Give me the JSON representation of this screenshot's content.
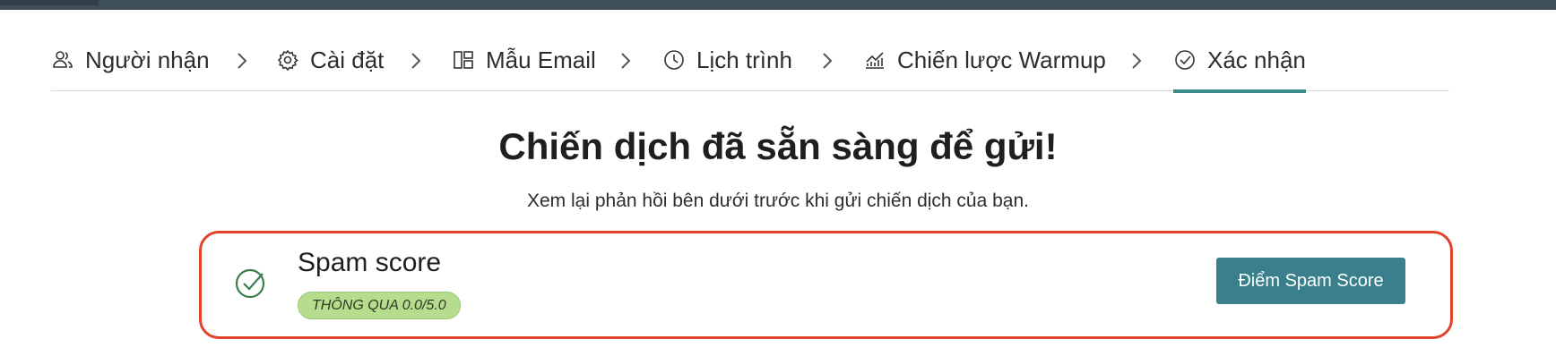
{
  "stepper": {
    "steps": [
      {
        "label": "Người nhận",
        "icon": "users-icon"
      },
      {
        "label": "Cài đặt",
        "icon": "gear-icon"
      },
      {
        "label": "Mẫu Email",
        "icon": "layout-icon"
      },
      {
        "label": "Lịch trình",
        "icon": "clock-icon"
      },
      {
        "label": "Chiến lược Warmup",
        "icon": "chart-up-icon"
      },
      {
        "label": "Xác nhận",
        "icon": "check-circle-icon"
      }
    ],
    "active_index": 5
  },
  "main": {
    "headline": "Chiến dịch đã sẵn sàng để gửi!",
    "subline": "Xem lại phản hồi bên dưới trước khi gửi chiến dịch của bạn."
  },
  "spam_card": {
    "title": "Spam score",
    "badge": "THÔNG QUA 0.0/5.0",
    "button_label": "Điểm Spam Score",
    "status_icon": "check-circle-icon"
  },
  "colors": {
    "accent": "#3a8d8a",
    "button": "#3a7f8c",
    "highlight_border": "#e2412b",
    "badge_bg": "#b6dd8e",
    "topbar": "#3f4f58"
  }
}
